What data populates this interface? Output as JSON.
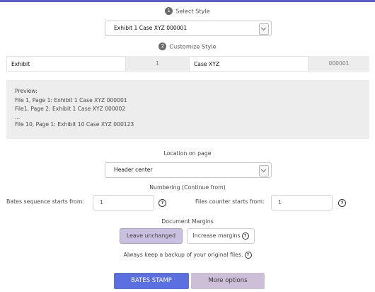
{
  "step1": {
    "number": "1",
    "title": "Select Style"
  },
  "style_select": {
    "value": "Exhibit 1 Case XYZ 000001"
  },
  "step2": {
    "number": "2",
    "title": "Customize Style"
  },
  "customize": {
    "prefix": "Exhibit",
    "file_number": "1",
    "suffix": "Case XYZ",
    "bates_number": "000001"
  },
  "preview": {
    "heading": "Preview:",
    "lines": [
      "File 1, Page 1: Exhibit 1 Case XYZ 000001",
      "File1, Page 2: Exhibit 1 Case XYZ 000002",
      "...",
      "File 10, Page 1: Exhibit 10 Case XYZ 000123"
    ]
  },
  "location": {
    "label": "Location on page",
    "value": "Header center"
  },
  "numbering": {
    "label": "Numbering (Continue from)",
    "bates_label": "Bates sequence starts from:",
    "bates_value": "1",
    "files_label": "Files counter starts from:",
    "files_value": "1"
  },
  "margins": {
    "label": "Document Margins",
    "leave_label": "Leave unchanged",
    "increase_label": "Increase margins"
  },
  "backup_note": "Always keep a backup of your original files.",
  "buttons": {
    "stamp": "BATES STAMP",
    "more": "More options"
  },
  "colors": {
    "accent": "#5b6fe0",
    "selected": "#c9c0e0",
    "secondary": "#cdbfd8"
  }
}
